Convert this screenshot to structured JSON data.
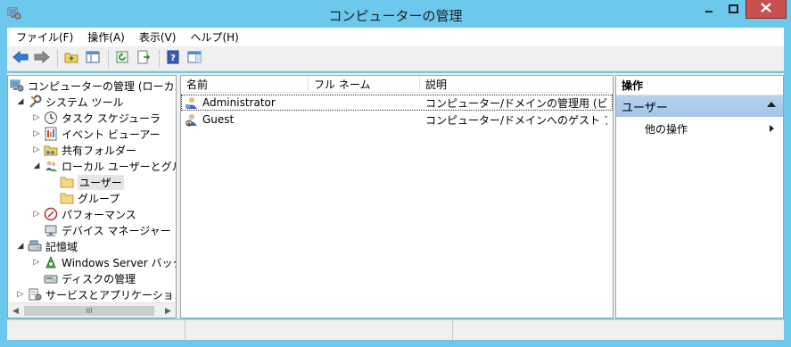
{
  "window": {
    "title": "コンピューターの管理",
    "icons": {
      "app": "computer-management-icon",
      "minimize": "minimize-icon",
      "maximize": "maximize-icon",
      "close": "close-icon"
    },
    "colors": {
      "frame": "#6cc8ec",
      "close": "#c75050",
      "selection": "#a8c8e8"
    }
  },
  "menubar": {
    "items": [
      {
        "label": "ファイル(F)"
      },
      {
        "label": "操作(A)"
      },
      {
        "label": "表示(V)"
      },
      {
        "label": "ヘルプ(H)"
      }
    ]
  },
  "toolbar": {
    "buttons": [
      "back-icon",
      "forward-icon",
      "up-folder-icon",
      "show-tree-icon",
      "refresh-icon",
      "export-list-icon",
      "help-icon",
      "show-action-pane-icon"
    ]
  },
  "tree": {
    "items": [
      {
        "label": "コンピューターの管理 (ローカル)",
        "icon": "computer-management-icon",
        "expander": ""
      },
      {
        "label": "システム ツール",
        "icon": "system-tools-icon",
        "expander": "◢"
      },
      {
        "label": "タスク スケジューラ",
        "icon": "task-scheduler-icon",
        "expander": "▷"
      },
      {
        "label": "イベント ビューアー",
        "icon": "event-viewer-icon",
        "expander": "▷"
      },
      {
        "label": "共有フォルダー",
        "icon": "shared-folder-icon",
        "expander": "▷"
      },
      {
        "label": "ローカル ユーザーとグループ",
        "icon": "local-users-groups-icon",
        "expander": "◢"
      },
      {
        "label": "ユーザー",
        "icon": "folder-icon",
        "expander": ""
      },
      {
        "label": "グループ",
        "icon": "folder-icon",
        "expander": ""
      },
      {
        "label": "パフォーマンス",
        "icon": "performance-icon",
        "expander": "▷"
      },
      {
        "label": "デバイス マネージャー",
        "icon": "device-manager-icon",
        "expander": ""
      },
      {
        "label": "記憶域",
        "icon": "storage-icon",
        "expander": "◢"
      },
      {
        "label": "Windows Server バックアップ",
        "icon": "backup-icon",
        "expander": "▷"
      },
      {
        "label": "ディスクの管理",
        "icon": "disk-management-icon",
        "expander": ""
      },
      {
        "label": "サービスとアプリケーション",
        "icon": "services-applications-icon",
        "expander": "▷"
      }
    ],
    "scrollbar": {
      "thumb_grip": "III"
    }
  },
  "list": {
    "columns": [
      "名前",
      "フル ネーム",
      "説明"
    ],
    "rows": [
      {
        "name": "Administrator",
        "full_name": "",
        "description": "コンピューター/ドメインの管理用 (ビルトイン アカウント)",
        "icon": "user-icon"
      },
      {
        "name": "Guest",
        "full_name": "",
        "description": "コンピューター/ドメインへのゲスト アクセス用 (ビルトイン アカウント)",
        "icon": "disabled-user-icon"
      }
    ]
  },
  "actions": {
    "title": "操作",
    "section": "ユーザー",
    "items": [
      {
        "label": "他の操作"
      }
    ]
  }
}
